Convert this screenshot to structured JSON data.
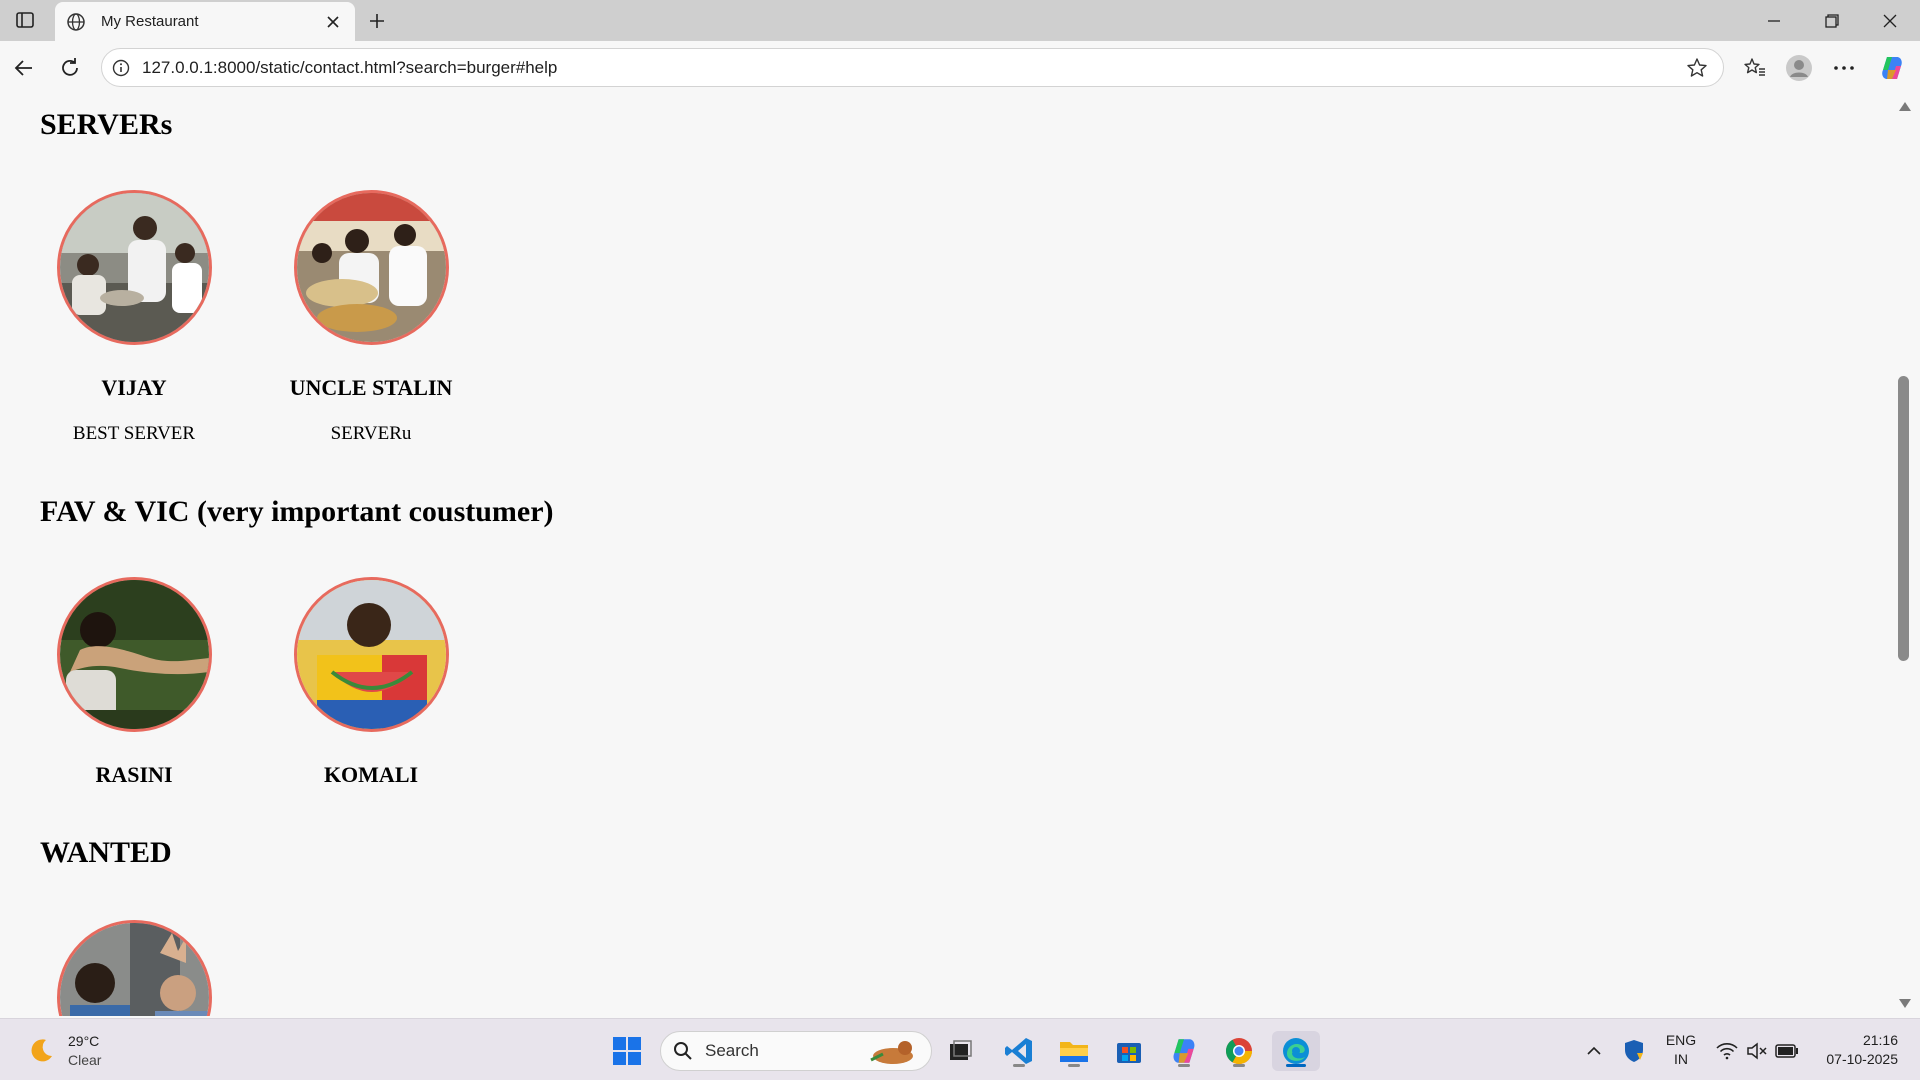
{
  "browser": {
    "tab_title": "My Restaurant",
    "url": "127.0.0.1:8000/static/contact.html?search=burger#help"
  },
  "page": {
    "sections": [
      {
        "heading": "SERVERs",
        "people": [
          {
            "name": "VIJAY",
            "role": "BEST SERVER"
          },
          {
            "name": "UNCLE STALIN",
            "role": "SERVERu"
          }
        ]
      },
      {
        "heading": "FAV & VIC (very important coustumer)",
        "people": [
          {
            "name": "RASINI"
          },
          {
            "name": "KOMALI"
          }
        ]
      },
      {
        "heading": "WANTED"
      }
    ],
    "avatar_border_color": "#e76a5e"
  },
  "taskbar": {
    "weather_temp": "29°C",
    "weather_cond": "Clear",
    "search_placeholder": "Search",
    "lang_top": "ENG",
    "lang_bottom": "IN",
    "time": "21:16",
    "date": "07-10-2025"
  }
}
